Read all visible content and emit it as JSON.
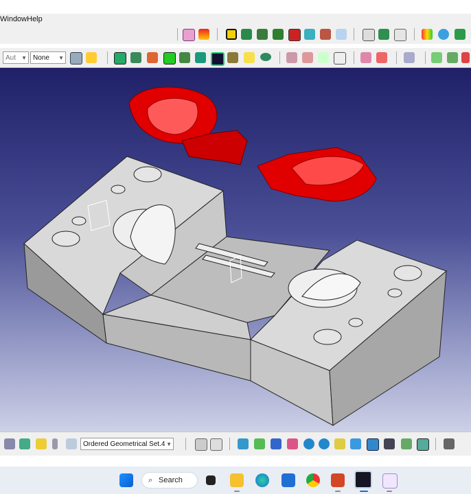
{
  "menu": {
    "window": "Window",
    "help": "Help"
  },
  "toolbar2": {
    "font_combo": "Aut",
    "line_combo": "None"
  },
  "bottom": {
    "set_combo": "Ordered Geometrical Set.4"
  },
  "taskbar": {
    "search_label": "Search"
  },
  "colors": {
    "part_red": "#e00000",
    "mold_gray": "#d7d7d7",
    "viewport_top": "#1f2068",
    "viewport_bottom": "#cdd0e6"
  },
  "icons": [
    "windows-start-icon",
    "search-icon",
    "task-view-icon",
    "file-explorer-icon",
    "edge-icon",
    "store-icon",
    "chrome-icon",
    "powerpoint-icon",
    "catia-icon",
    "paint-icon"
  ]
}
